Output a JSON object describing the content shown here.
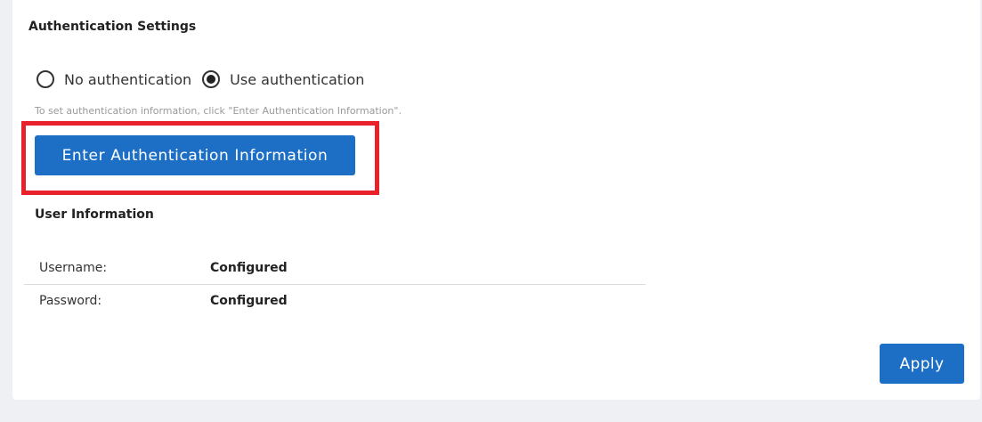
{
  "auth_settings": {
    "title": "Authentication Settings",
    "options": [
      {
        "label": "No authentication",
        "checked": false
      },
      {
        "label": "Use authentication",
        "checked": true
      }
    ],
    "hint": "To set authentication information, click \"Enter Authentication Information\".",
    "enter_button_label": "Enter Authentication Information"
  },
  "user_info": {
    "title": "User Information",
    "rows": [
      {
        "label": "Username:",
        "value": "Configured"
      },
      {
        "label": "Password:",
        "value": "Configured"
      }
    ]
  },
  "footer": {
    "apply_label": "Apply"
  },
  "colors": {
    "primary": "#1c6fc4",
    "highlight": "#e8212b",
    "page_background": "#eef0f4"
  }
}
